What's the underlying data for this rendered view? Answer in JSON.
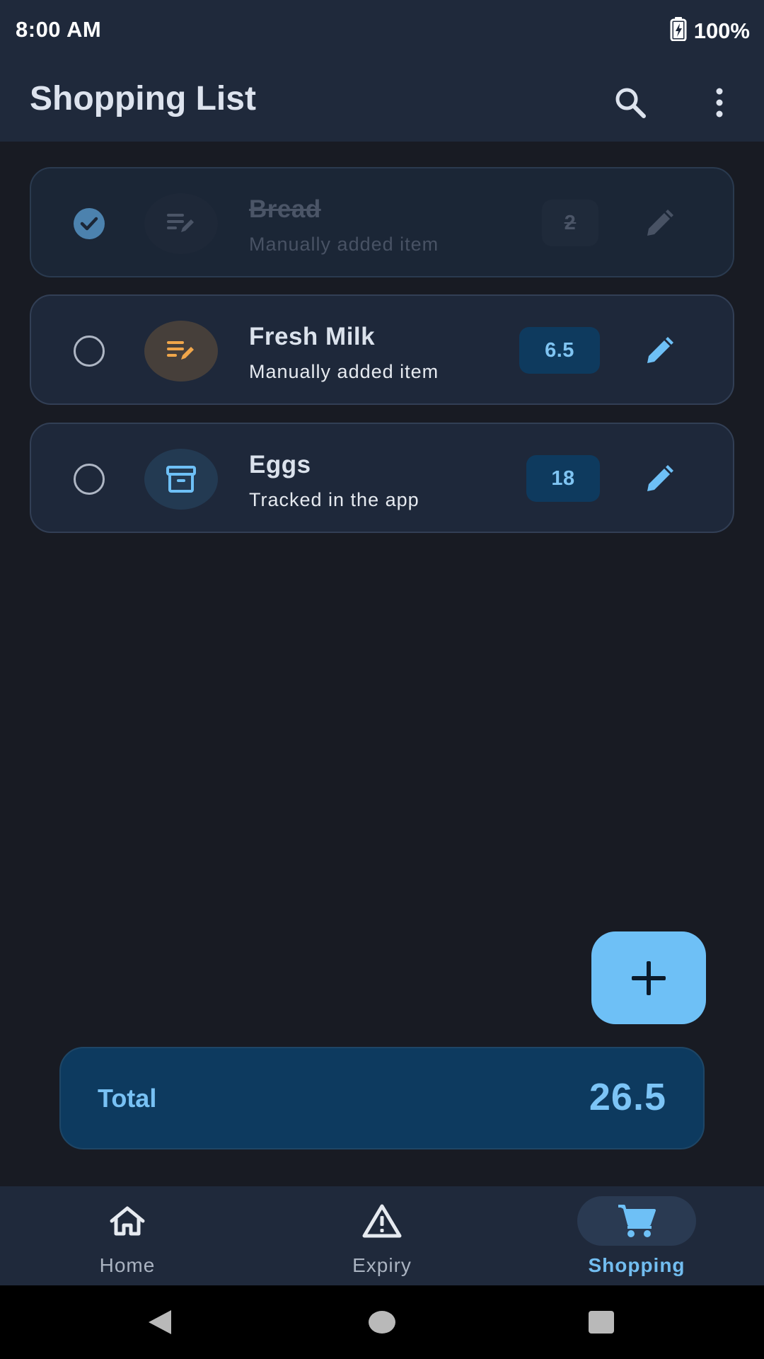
{
  "status_bar": {
    "time": "8:00 AM",
    "battery": "100%",
    "battery_icon": "battery-charging-icon"
  },
  "app_bar": {
    "title": "Shopping List",
    "actions": [
      "search-icon",
      "more-vert-icon"
    ]
  },
  "items": [
    {
      "name": "Bread",
      "subtitle": "Manually added item",
      "quantity": "2",
      "checked": true,
      "type_icon": "edit-note-icon"
    },
    {
      "name": "Fresh Milk",
      "subtitle": "Manually added item",
      "quantity": "6.5",
      "checked": false,
      "type_icon": "edit-note-icon"
    },
    {
      "name": "Eggs",
      "subtitle": "Tracked in the app",
      "quantity": "18",
      "checked": false,
      "type_icon": "inventory-box-icon"
    }
  ],
  "fab": {
    "icon": "plus-icon"
  },
  "total": {
    "label": "Total",
    "value": "26.5"
  },
  "bottom_nav": {
    "items": [
      {
        "label": "Home",
        "icon": "home-icon",
        "active": false
      },
      {
        "label": "Expiry",
        "icon": "warning-icon",
        "active": false
      },
      {
        "label": "Shopping",
        "icon": "cart-icon",
        "active": true
      }
    ]
  },
  "colors": {
    "background": "#181b23",
    "surface": "#1f293b",
    "card": "#1e283a",
    "accent": "#6ec0f6",
    "chip": "#0e3a5e",
    "manual_icon": "#f0a64a",
    "tracked_icon": "#6ec0f6"
  }
}
